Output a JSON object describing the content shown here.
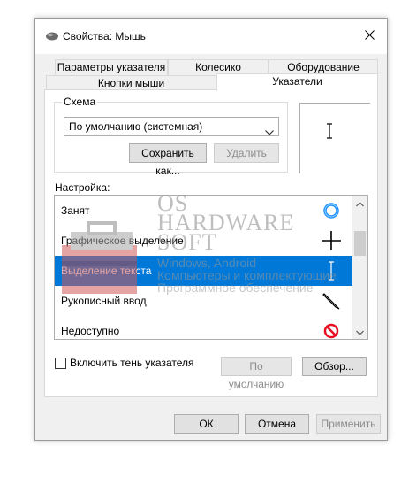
{
  "window": {
    "title": "Свойства: Мышь"
  },
  "tabs": {
    "row1": [
      "Параметры указателя",
      "Колесико",
      "Оборудование"
    ],
    "row2": [
      "Кнопки мыши",
      "Указатели"
    ]
  },
  "scheme": {
    "label": "Схема",
    "selected": "По умолчанию (системная)",
    "save_label": "Сохранить как...",
    "delete_label": "Удалить"
  },
  "customize": {
    "label": "Настройка:",
    "items": [
      {
        "name": "Занят",
        "icon": "busy-ring-icon"
      },
      {
        "name": "Графическое выделение",
        "icon": "crosshair-icon"
      },
      {
        "name": "Выделение текста",
        "icon": "text-beam-icon"
      },
      {
        "name": "Рукописный ввод",
        "icon": "pen-icon"
      },
      {
        "name": "Недоступно",
        "icon": "unavailable-icon"
      }
    ],
    "selected_index": 2
  },
  "shadow": {
    "label": "Включить тень указателя"
  },
  "actions": {
    "default_label": "По умолчанию",
    "browse_label": "Обзор..."
  },
  "footer": {
    "ok_label": "ОК",
    "cancel_label": "Отмена",
    "apply_label": "Применить"
  },
  "watermark": {
    "lines": [
      "OS",
      "HARDWARE",
      "SOFT"
    ],
    "small": [
      "Windows, Android",
      "Компьютеры и комплектующие",
      "Программное обеспечение"
    ]
  },
  "colors": {
    "accent": "#0078d7",
    "busy": "#1e90ff",
    "unavailable": "#e81123"
  }
}
